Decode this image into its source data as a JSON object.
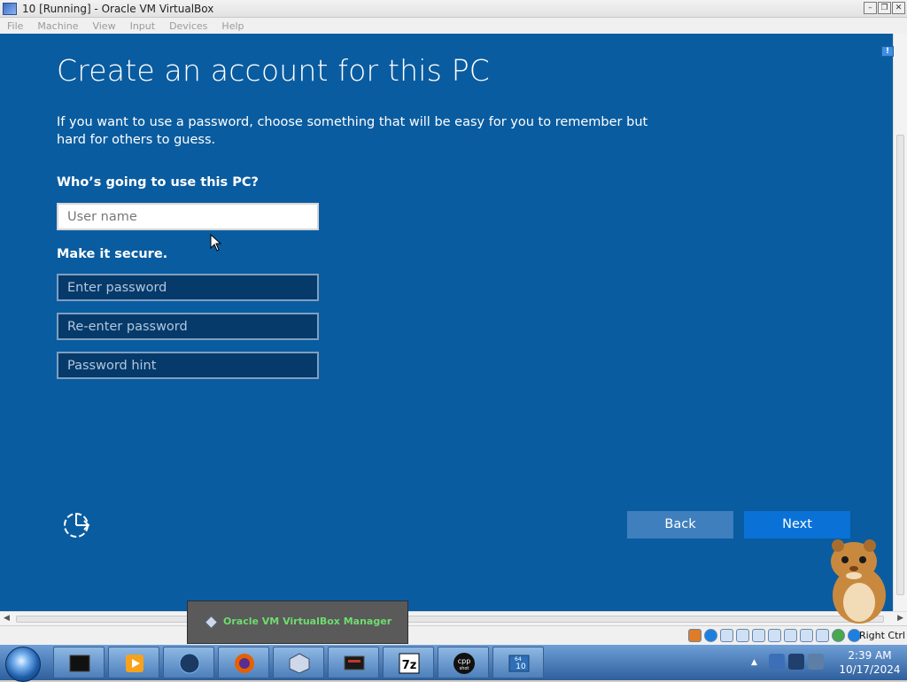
{
  "window": {
    "title": "10 [Running] - Oracle VM VirtualBox",
    "controls": {
      "minimize": "–",
      "restore": "❐",
      "close": "✕"
    }
  },
  "menubar": [
    "File",
    "Machine",
    "View",
    "Input",
    "Devices",
    "Help"
  ],
  "oobe": {
    "title": "Create an account for this PC",
    "description": "If you want to use a password, choose something that will be easy for you to remember but hard for others to guess.",
    "question_label": "Who’s going to use this PC?",
    "secure_label": "Make it secure.",
    "username_placeholder": "User name",
    "password_placeholder": "Enter password",
    "reenter_placeholder": "Re-enter password",
    "hint_placeholder": "Password hint",
    "back_label": "Back",
    "next_label": "Next",
    "accessibility_icon": "ease-of-access-icon"
  },
  "statusbar": {
    "host_key": "Right Ctrl"
  },
  "host_popup": {
    "label": "Oracle VM VirtualBox Manager"
  },
  "taskbar": {
    "apps": [
      "terminal",
      "media-player",
      "earth",
      "firefox",
      "virtualbox",
      "screen",
      "7zip",
      "cpp-shot",
      "windows-10-vm"
    ],
    "seven_zip_label": "7z",
    "cpp_label": "cpp",
    "cpp_sub": "shot",
    "vm_label": "10",
    "vm_badge": "64",
    "clock_time": "2:39 AM",
    "clock_date": "10/17/2024"
  },
  "colors": {
    "oobe_background": "#0a5ca0",
    "next_button": "#0a72d6",
    "back_button": "#3f7fbd"
  }
}
